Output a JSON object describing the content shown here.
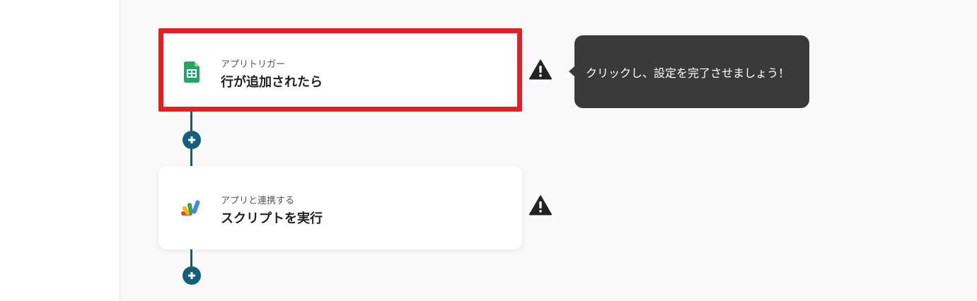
{
  "flow": {
    "trigger": {
      "subtitle": "アプリトリガー",
      "title": "行が追加されたら",
      "app_icon": "google-sheets-icon",
      "selected": true
    },
    "action": {
      "subtitle": "アプリと連携する",
      "title": "スクリプトを実行",
      "app_icon": "google-apps-script-icon"
    },
    "tooltip": {
      "text": "クリックし、設定を完了させましょう！"
    },
    "colors": {
      "selected_border": "#e41f25",
      "connector": "#1e5a6e",
      "add_button": "#14607a",
      "tooltip_bg": "#3a3a3a",
      "canvas_bg": "#f9f9f9"
    },
    "icons": {
      "add": "plus-icon",
      "warning": "warning-icon"
    }
  }
}
